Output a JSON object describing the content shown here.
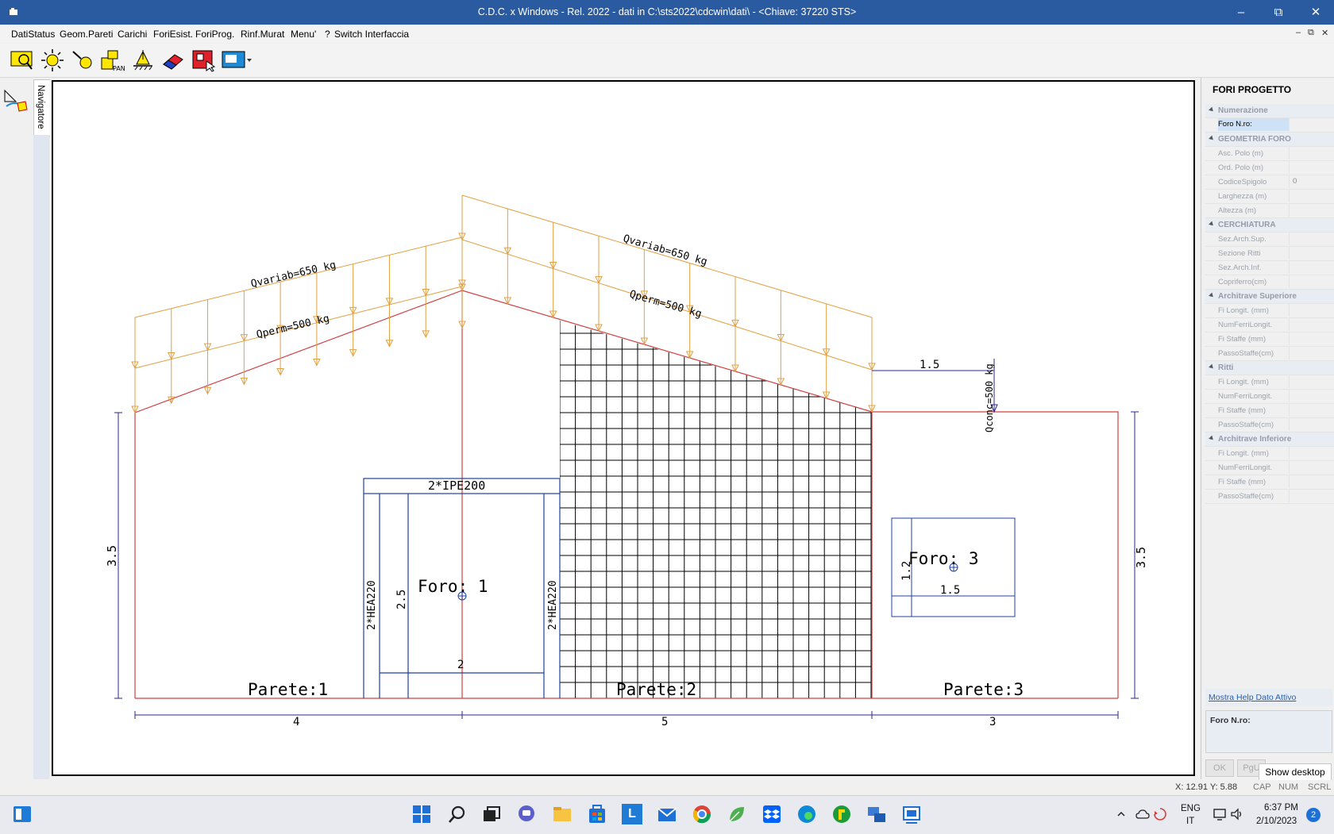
{
  "window": {
    "title": "C.D.C. x Windows - Rel. 2022 - dati in C:\\sts2022\\cdcwin\\dati\\ - <Chiave: 37220 STS>",
    "min": "–",
    "max": "⧉",
    "close": "✕"
  },
  "menu": [
    "DatiStatus",
    "Geom.Pareti",
    "Carichi",
    "ForiEsist.",
    "ForiProg.",
    "Rinf.Murat",
    "Menu'",
    "?",
    "Switch Interfaccia"
  ],
  "mdi": {
    "min": "–",
    "restore": "⧉",
    "close": "✕"
  },
  "toolbar_icons": [
    "select-window-icon",
    "zoom-extents-icon",
    "zoom-icon",
    "pan-icon",
    "support-icon",
    "eraser-icon",
    "red-pick-icon",
    "view-dropdown-icon"
  ],
  "toolbar_pan_text": "PAN",
  "navigator_tab": "Navigatore",
  "drawing": {
    "load_var_left": "Qvariab=650 kg",
    "load_perm_left": "Qperm=500 kg",
    "load_var_right": "Qvariab=650 kg",
    "load_perm_right": "Qperm=500 kg",
    "load_conc": "Qconc=500 kg",
    "dim_conc": "1.5",
    "lintel": "2*IPE200",
    "post_left": "2*HEA220",
    "post_right": "2*HEA220",
    "foro1": "Foro: 1",
    "foro1_h": "2.5",
    "foro1_w": "2",
    "foro3": "Foro: 3",
    "foro3_h": "1.2",
    "foro3_w": "1.5",
    "parete1": "Parete:1",
    "parete2": "Parete:2",
    "parete3": "Parete:3",
    "height_left": "3.5",
    "height_right": "3.5",
    "dim1": "4",
    "dim2": "5",
    "dim3": "3"
  },
  "panel": {
    "title": "FORI PROGETTO",
    "rows": [
      {
        "label": "Numerazione",
        "cat": true
      },
      {
        "label": "Foro N.ro:",
        "value": "",
        "sel": true
      },
      {
        "label": "GEOMETRIA FORO",
        "cat": true
      },
      {
        "label": "Asc. Polo (m)",
        "value": ""
      },
      {
        "label": "Ord. Polo (m)",
        "value": ""
      },
      {
        "label": "CodiceSpigolo",
        "value": "0"
      },
      {
        "label": "Larghezza (m)",
        "value": ""
      },
      {
        "label": "Altezza   (m)",
        "value": ""
      },
      {
        "label": "CERCHIATURA",
        "cat": true
      },
      {
        "label": "Sez.Arch.Sup.",
        "value": ""
      },
      {
        "label": "Sezione Ritti",
        "value": ""
      },
      {
        "label": "Sez.Arch.Inf.",
        "value": ""
      },
      {
        "label": "Copriferro(cm)",
        "value": ""
      },
      {
        "label": "Architrave Superiore",
        "cat": true
      },
      {
        "label": "Fi Longit. (mm)",
        "value": ""
      },
      {
        "label": "NumFerriLongit.",
        "value": ""
      },
      {
        "label": "Fi Staffe  (mm)",
        "value": ""
      },
      {
        "label": "PassoStaffe(cm)",
        "value": ""
      },
      {
        "label": "Ritti",
        "cat": true
      },
      {
        "label": "Fi Longit. (mm)",
        "value": ""
      },
      {
        "label": "NumFerriLongit.",
        "value": ""
      },
      {
        "label": "Fi Staffe  (mm)",
        "value": ""
      },
      {
        "label": "PassoStaffe(cm)",
        "value": ""
      },
      {
        "label": "Architrave Inferiore",
        "cat": true
      },
      {
        "label": "Fi Longit. (mm)",
        "value": ""
      },
      {
        "label": "NumFerriLongit.",
        "value": ""
      },
      {
        "label": "Fi Staffe  (mm)",
        "value": ""
      },
      {
        "label": "PassoStaffe(cm)",
        "value": ""
      }
    ],
    "help_link": "Mostra Help Dato Attivo",
    "help_title": "Foro N.ro:",
    "btn_ok": "OK",
    "btn_pgu": "PgU"
  },
  "tooltip": "Show desktop",
  "status": {
    "coords": "X: 12.91  Y: 5.88",
    "cap": "CAP",
    "num": "NUM",
    "scrl": "SCRL"
  },
  "taskbar": {
    "lang": "ENG",
    "region": "IT",
    "time": "6:37 PM",
    "date": "2/10/2023",
    "notif": "2",
    "app_l": "L"
  }
}
